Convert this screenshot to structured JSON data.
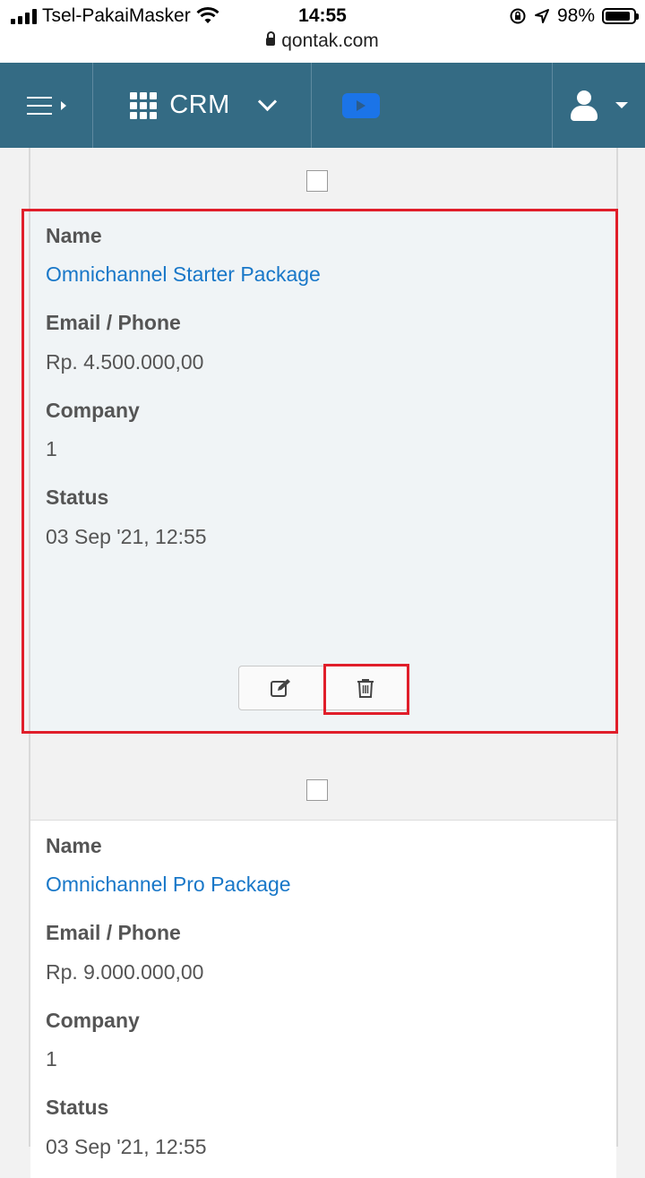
{
  "status_bar": {
    "carrier": "Tsel-PakaiMasker",
    "time": "14:55",
    "battery": "98%",
    "battery_level": 0.98,
    "url": "qontak.com"
  },
  "navbar": {
    "menu_icon": "hamburger-menu-icon",
    "app_label": "CRM",
    "video_icon": "youtube-play-icon",
    "user_icon": "user-icon"
  },
  "records": [
    {
      "name_label": "Name",
      "name": "Omnichannel Starter Package",
      "email_label": "Email / Phone",
      "email": "Rp. 4.500.000,00",
      "company_label": "Company",
      "company": "1",
      "status_label": "Status",
      "status": "03 Sep '21, 12:55",
      "actions": {
        "edit_icon": "edit-icon",
        "delete_icon": "trash-icon"
      }
    },
    {
      "name_label": "Name",
      "name": "Omnichannel Pro Package",
      "email_label": "Email / Phone",
      "email": "Rp. 9.000.000,00",
      "company_label": "Company",
      "company": "1",
      "status_label": "Status",
      "status": "03 Sep '21, 12:55"
    }
  ],
  "colors": {
    "navbar": "#346b84",
    "link": "#1877c8",
    "highlight": "#e01e2a"
  }
}
